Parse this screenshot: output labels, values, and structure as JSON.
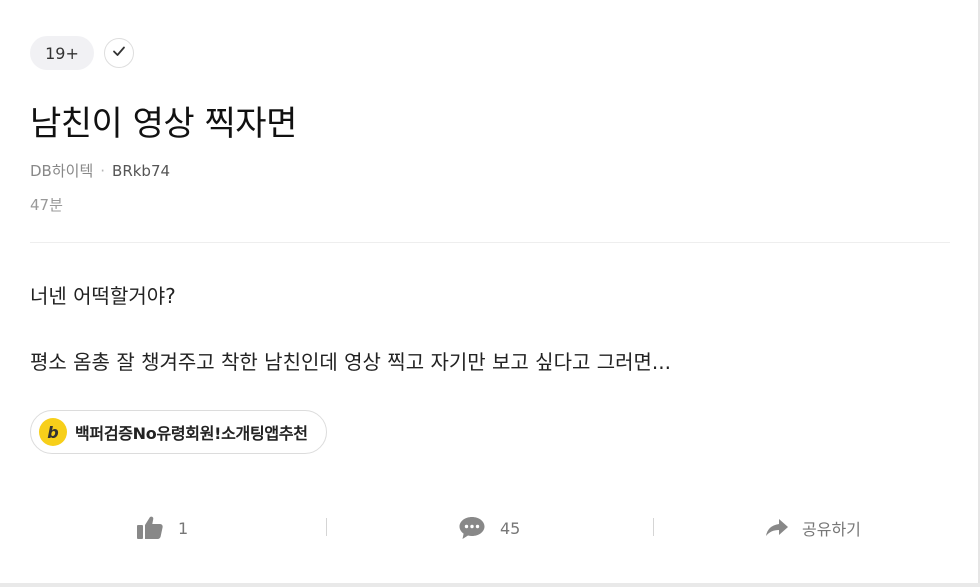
{
  "post": {
    "age_badge": "19+",
    "title": "남친이 영상 찍자면",
    "company": "DB하이텍",
    "author": "BRkb74",
    "time": "47분",
    "body": [
      "너넨 어떡할거야?",
      "평소 옴총 잘 챙겨주고 착한 남친인데 영상 찍고 자기만 보고 싶다고 그러면..."
    ]
  },
  "ad": {
    "logo_letter": "b",
    "text": "백퍼검증No유령회원!소개팅앱추천",
    "logo_color": "#f7cf1a"
  },
  "actions": {
    "like_count": "1",
    "comment_count": "45",
    "share_label": "공유하기"
  },
  "icons": {
    "check": "check-icon",
    "like": "thumbs-up-icon",
    "comment": "comment-bubble-icon",
    "share": "share-arrow-icon"
  }
}
